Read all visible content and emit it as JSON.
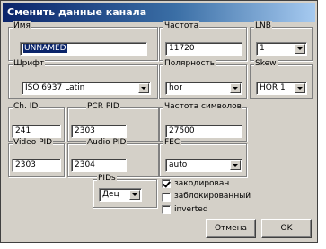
{
  "window": {
    "title": "Сменить данные канала"
  },
  "name": {
    "label": "Имя",
    "value": "UNNAMED"
  },
  "frequency": {
    "label": "Частота",
    "value": "11720"
  },
  "lnb": {
    "label": "LNB",
    "value": "1"
  },
  "font": {
    "label": "Шрифт",
    "value": "ISO 6937 Latin"
  },
  "polarity": {
    "label": "Полярность",
    "value": "hor"
  },
  "skew": {
    "label": "Skew",
    "value": "HOR 1"
  },
  "ch_id": {
    "label": "Ch. ID",
    "value": "241"
  },
  "pcr_pid": {
    "label": "PCR PID",
    "value": "2303"
  },
  "symbol_rate": {
    "label": "Частота символов",
    "value": "27500"
  },
  "video_pid": {
    "label": "Video PID",
    "value": "2303"
  },
  "audio_pid": {
    "label": "Audio PID",
    "value": "2304"
  },
  "fec": {
    "label": "FEC",
    "value": "auto"
  },
  "pids": {
    "label": "PIDs",
    "value": "Дец"
  },
  "checkboxes": [
    {
      "label": "закодирован",
      "checked": true
    },
    {
      "label": "заблокированный",
      "checked": false
    },
    {
      "label": "inverted",
      "checked": false
    }
  ],
  "buttons": {
    "cancel": "Отмена",
    "ok": "OK"
  }
}
